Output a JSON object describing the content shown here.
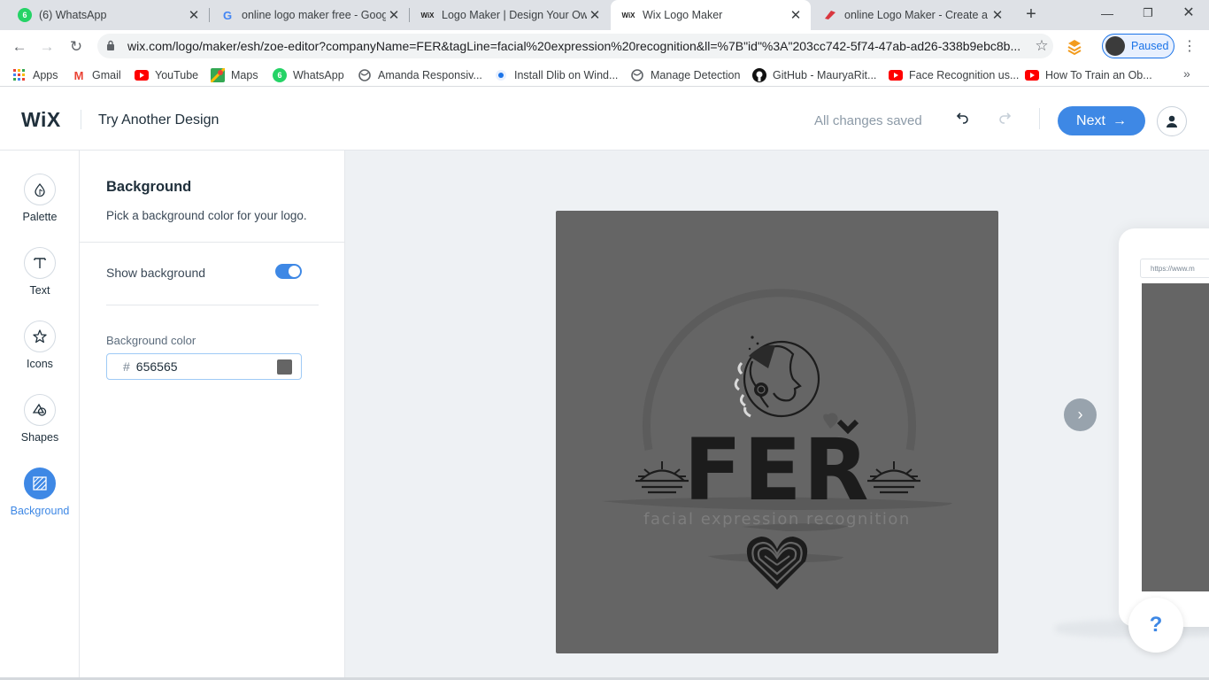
{
  "browser": {
    "tabs": [
      {
        "title": "(6) WhatsApp",
        "icon": "whatsapp-icon",
        "badge": "6"
      },
      {
        "title": "online logo maker free - Goog",
        "icon": "google-icon",
        "badge": "G"
      },
      {
        "title": "Logo Maker | Design Your Own",
        "icon": "wix-icon",
        "badge": "WiX"
      },
      {
        "title": "Wix Logo Maker",
        "icon": "wix-icon",
        "badge": "WiX"
      },
      {
        "title": "online Logo Maker - Create a c",
        "icon": "logo-maker-icon",
        "badge": ""
      }
    ],
    "url": "wix.com/logo/maker/esh/zoe-editor?companyName=FER&tagLine=facial%20expression%20recognition&ll=%7B\"id\"%3A\"203cc742-5f74-47ab-ad26-338b9ebc8b...",
    "profile_status": "Paused",
    "bookmarks": [
      {
        "label": "Apps",
        "icon": "apps-grid-icon"
      },
      {
        "label": "Gmail",
        "icon": "gmail-icon"
      },
      {
        "label": "YouTube",
        "icon": "youtube-icon"
      },
      {
        "label": "Maps",
        "icon": "maps-icon"
      },
      {
        "label": "WhatsApp",
        "icon": "whatsapp-icon"
      },
      {
        "label": "Amanda Responsiv...",
        "icon": "globe-icon"
      },
      {
        "label": "Install Dlib on Wind...",
        "icon": "dlib-icon"
      },
      {
        "label": "Manage Detection",
        "icon": "globe-icon"
      },
      {
        "label": "GitHub - MauryaRit...",
        "icon": "github-icon"
      },
      {
        "label": "Face Recognition us...",
        "icon": "youtube-icon"
      },
      {
        "label": "How To Train an Ob...",
        "icon": "youtube-icon"
      }
    ]
  },
  "header": {
    "logo": "WiX",
    "title": "Try Another Design",
    "status": "All changes saved",
    "next_label": "Next"
  },
  "rail": {
    "items": [
      {
        "label": "Palette",
        "icon": "palette-drop-icon"
      },
      {
        "label": "Text",
        "icon": "text-icon"
      },
      {
        "label": "Icons",
        "icon": "star-icon"
      },
      {
        "label": "Shapes",
        "icon": "shapes-icon"
      },
      {
        "label": "Background",
        "icon": "background-hatch-icon",
        "selected": true
      }
    ]
  },
  "panel": {
    "title": "Background",
    "subtitle": "Pick a background color for your logo.",
    "show_background_label": "Show background",
    "show_background": true,
    "color_label": "Background color",
    "hash": "#",
    "color_value": "656565"
  },
  "logo_preview": {
    "company_name": "FER",
    "tagline": "facial expression recognition",
    "background_color": "#656565",
    "ink_color": "#1c1c1c",
    "tagline_color": "#7d7d7d"
  },
  "mockup": {
    "url": "https://www.m"
  },
  "help_label": "?",
  "colors": {
    "accent": "#3e88e5",
    "tabstrip": "#dee1e6"
  }
}
